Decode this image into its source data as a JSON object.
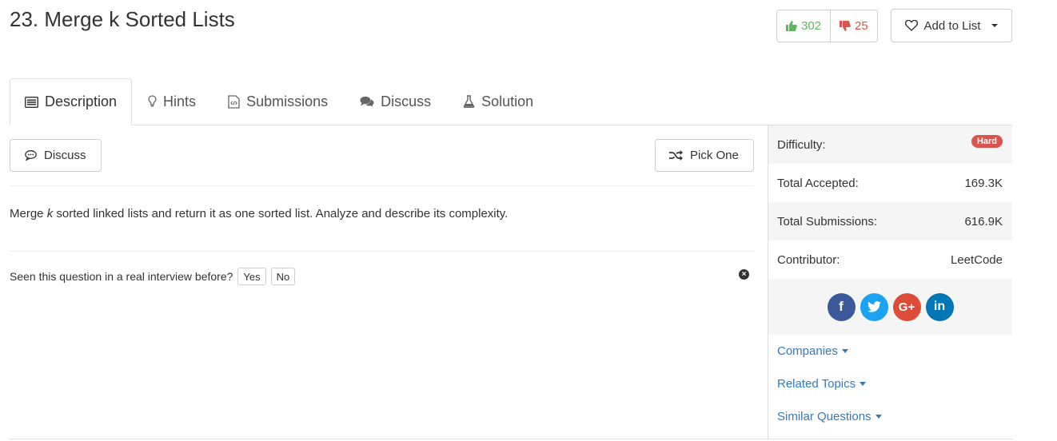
{
  "problem": {
    "title": "23. Merge k Sorted Lists"
  },
  "votes": {
    "up": "302",
    "down": "25",
    "up_color": "#5cb85c",
    "down_color": "#d9534f"
  },
  "add_to_list": "Add to List",
  "tabs": [
    {
      "label": "Description",
      "icon": "list-icon",
      "active": true
    },
    {
      "label": "Hints",
      "icon": "lightbulb-icon"
    },
    {
      "label": "Submissions",
      "icon": "code-file-icon"
    },
    {
      "label": "Discuss",
      "icon": "comments-icon"
    },
    {
      "label": "Solution",
      "icon": "flask-icon"
    }
  ],
  "buttons": {
    "discuss": "Discuss",
    "pick_one": "Pick One"
  },
  "description": {
    "pre": "Merge ",
    "em": "k",
    "post": " sorted linked lists and return it as one sorted list. Analyze and describe its complexity."
  },
  "interview": {
    "question": "Seen this question in a real interview before?",
    "yes": "Yes",
    "no": "No"
  },
  "stats": {
    "difficulty_label": "Difficulty:",
    "difficulty": "Hard",
    "difficulty_color": "#d9534f",
    "accepted_label": "Total Accepted:",
    "accepted": "169.3K",
    "submissions_label": "Total Submissions:",
    "submissions": "616.9K",
    "contributor_label": "Contributor:",
    "contributor": "LeetCode"
  },
  "social": [
    {
      "name": "facebook-icon",
      "glyph": "f",
      "color": "#3b5998"
    },
    {
      "name": "twitter-icon",
      "glyph": "t",
      "color": "#1da1f2"
    },
    {
      "name": "google-plus-icon",
      "glyph": "G+",
      "color": "#dd4b39"
    },
    {
      "name": "linkedin-icon",
      "glyph": "in",
      "color": "#0077b5"
    }
  ],
  "links": {
    "companies": "Companies",
    "related_topics": "Related Topics",
    "similar_questions": "Similar Questions"
  },
  "link_color": "#337ab7"
}
